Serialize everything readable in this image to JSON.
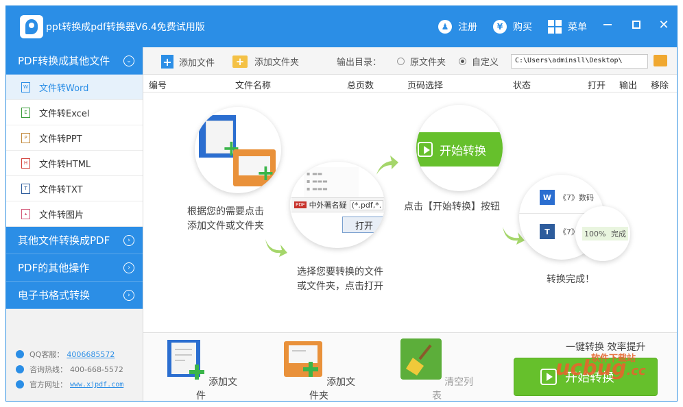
{
  "app": {
    "title": "ppt转换成pdf转换器V6.4免费试用版"
  },
  "titlebar": {
    "register": "注册",
    "buy": "购买",
    "menu": "菜单"
  },
  "sidebar": {
    "group1": "PDF转换成其他文件",
    "items": [
      "文件转Word",
      "文件转Excel",
      "文件转PPT",
      "文件转HTML",
      "文件转TXT",
      "文件转图片"
    ],
    "group2": "其他文件转换成PDF",
    "group3": "PDF的其他操作",
    "group4": "电子书格式转换",
    "contact": {
      "qq_label": "QQ客服：",
      "qq": "4006685572",
      "hotline_label": "咨询热线：",
      "hotline": "400-668-5572",
      "site_label": "官方网址：",
      "site": "www.xjpdf.com"
    }
  },
  "toolbar": {
    "add_file": "添加文件",
    "add_folder": "添加文件夹",
    "output_label": "输出目录：",
    "opt_original": "原文件夹",
    "opt_custom": "自定义",
    "path": "C:\\Users\\adminsll\\Desktop\\"
  },
  "table": {
    "columns": [
      "编号",
      "文件名称",
      "总页数",
      "页码选择",
      "状态",
      "打开",
      "输出",
      "移除"
    ]
  },
  "illustration": {
    "step1": [
      "根据您的需要点击",
      "添加文件或文件夹"
    ],
    "step2": [
      "选择您要转换的文件",
      "或文件夹，点击打开"
    ],
    "step3": "点击【开始转换】按钮",
    "step4": "转换完成！",
    "dialog_file": "中外著名疑",
    "dialog_filter": "(*.pdf,*.",
    "dialog_open": "打开",
    "start_label": "开始转换",
    "done_item": "《7》数码",
    "done_item2": "《7》",
    "progress": "100%",
    "done_text": "完成"
  },
  "bottom": {
    "add_file": "添加文件",
    "add_folder": "添加文件夹",
    "clear": "清空列表",
    "slogan": "一键转换  效率提升",
    "start": "开始转换"
  },
  "watermark": {
    "brand": "ucbug",
    "sub": "软件下载站",
    "cc": ".cc"
  },
  "colors": {
    "primary": "#2b8ee6",
    "start_green": "#66c02c",
    "folder": "#f4c145"
  }
}
